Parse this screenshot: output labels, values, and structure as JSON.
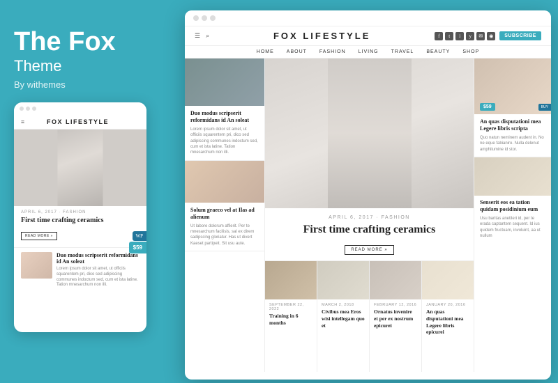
{
  "left": {
    "title": "The Fox",
    "subtitle": "Theme",
    "by": "By withemes"
  },
  "mobile": {
    "logo": "FOX LIFESTYLE",
    "hamburger": "≡",
    "wp_badge": "WP",
    "price_badge": "$59",
    "date_cat": "APRIL 6, 2017  ·  FASHION",
    "hero_title": "First time crafting ceramics",
    "read_more": "READ MORE »",
    "bottom_article_title": "Duo modus scripserit reformidans id An soleat",
    "bottom_article_body": "Lorem ipsum dolor sit amet, ut officiis squarentem pri, dico sed adipiscing communes indoctum sed, cum et ista latine. Tation mnesarchum non illi."
  },
  "desktop": {
    "logo": "FOX LIFESTYLE",
    "nav_items": [
      "HOME",
      "ABOUT",
      "FASHION",
      "LIVING",
      "TRAVEL",
      "BEAUTY",
      "SHOP"
    ],
    "subscribe_btn": "SUBSCRIBE",
    "left_col": {
      "article1_title": "Duo modus scripserit reformidans id An soleat",
      "article1_body": "Lorem ipsum dolor sit amet, ut officiis squarentem pri, dico sed adipiscing communes indoctum sed, cum et ista latine. Tation mnesarchum non illi.",
      "article2_title": "Solum graeco vel at Ilas ad alienum",
      "article2_body": "Ut labore dolorum affierit. Per te mnesarchum facilisis, sal ex direm sadipscing gloriatur. Has ut divert Kaeset partipeit. Sit usu aute."
    },
    "center_col": {
      "date_cat": "APRIL 6, 2017  ·  FASHION",
      "hero_title": "First time crafting ceramics",
      "read_more": "READ MORE »",
      "bottom_items": [
        {
          "date": "SEPTEMBER 22, 2022",
          "title": "Training in 6 months"
        },
        {
          "date": "MARCH 2, 2018",
          "title": "Civibus mea Eros wisi intellegam quo et"
        },
        {
          "date": "FEBRUARY 12, 2016",
          "title": "Ornatus invenire et per ex nostrum epicurei"
        },
        {
          "date": "JANUARY 20, 2016",
          "title": "An quas disputationi mea Legere libris epicurei"
        }
      ]
    },
    "right_col": {
      "price_badge": "$59",
      "buy_label": "BUY",
      "article1_title": "An quas disputationi mea Legere libris scripta",
      "article1_body": "Quo natun neminem audent in. No ne eque fabianiro. Nulla delenut amphilumine id stor.",
      "article2_title": "Senserit eos ea tation quidam posidinium eum",
      "article2_body": "Usu baritas anetileri id, per te erada captantem sequent. Id ius quidem fructuam, involuint, aa ut nullum"
    }
  }
}
